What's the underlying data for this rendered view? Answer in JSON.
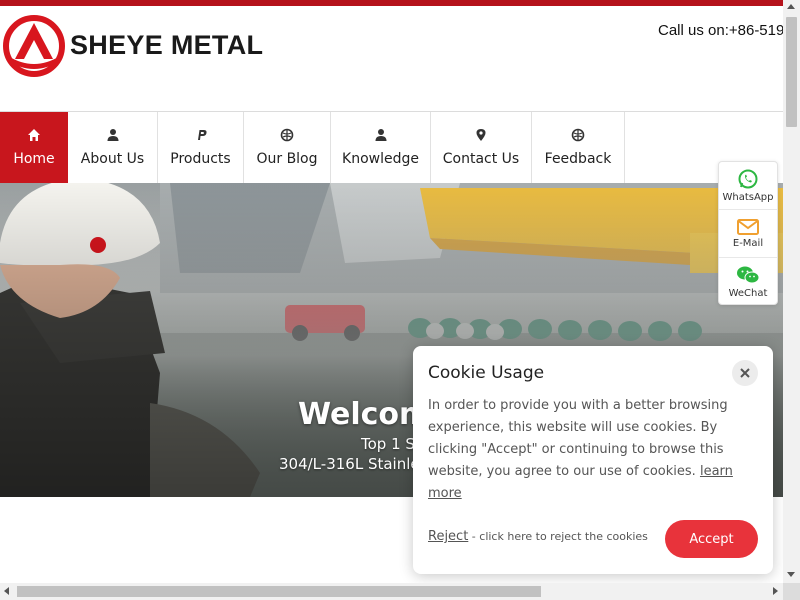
{
  "header": {
    "brand_name": "SHEYE METAL",
    "phone": "Call us on:+86-519",
    "logo_icon": "sheye-logo-icon",
    "brand_color": "#c8161d"
  },
  "nav": {
    "items": [
      {
        "label": "Home",
        "icon": "home-icon",
        "active": true
      },
      {
        "label": "About Us",
        "icon": "user-icon"
      },
      {
        "label": "Products",
        "icon": "product-icon"
      },
      {
        "label": "Our Blog",
        "icon": "blog-icon"
      },
      {
        "label": "Knowledge",
        "icon": "user-icon"
      },
      {
        "label": "Contact Us",
        "icon": "location-icon"
      },
      {
        "label": "Feedback",
        "icon": "feedback-icon"
      }
    ]
  },
  "hero": {
    "title": "Welcom",
    "subtitle_line1": "Top 1 S",
    "subtitle_line2": "304/L-316L Stainles"
  },
  "side_contact": {
    "items": [
      {
        "label": "WhatsApp",
        "icon": "whatsapp-icon",
        "color": "#2db742"
      },
      {
        "label": "E-Mail",
        "icon": "mail-icon",
        "color": "#f0a030"
      },
      {
        "label": "WeChat",
        "icon": "wechat-icon",
        "color": "#2db742"
      }
    ]
  },
  "cookie": {
    "title": "Cookie Usage",
    "body": "In order to provide you with a better browsing experience, this website will use cookies. By clicking \"Accept\" or continuing to browse this website, you agree to our use of cookies.",
    "learn_more": "learn more",
    "reject_label": "Reject",
    "reject_hint": " - click here to reject the cookies",
    "accept_label": "Accept",
    "accept_color": "#e8333b"
  }
}
